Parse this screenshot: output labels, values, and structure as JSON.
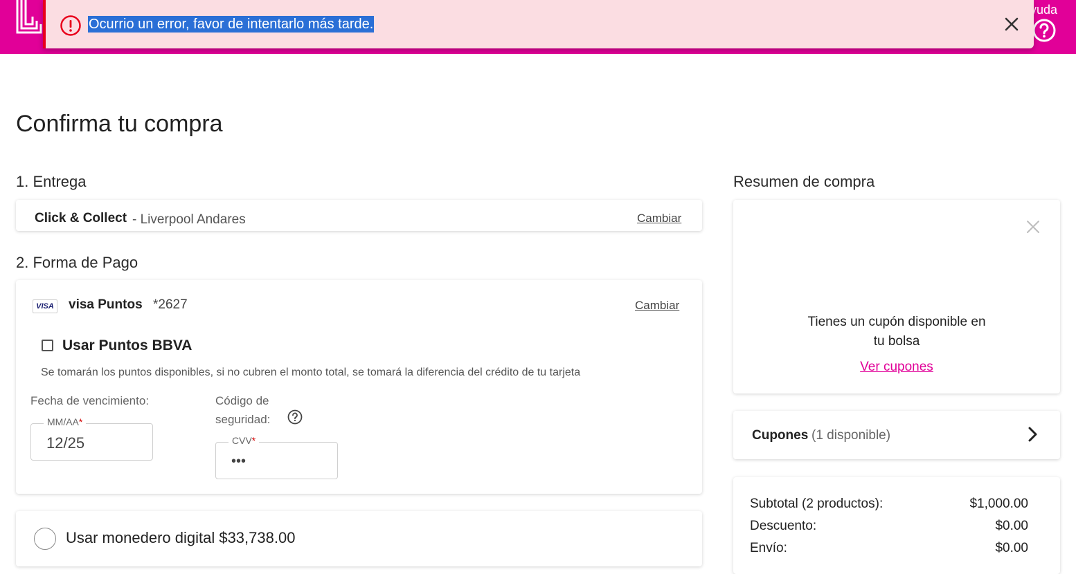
{
  "header": {
    "help_label": "yuda",
    "brand_color": "#e10098"
  },
  "alert": {
    "message": "Ocurrio un error, favor de intentarlo más tarde.",
    "icon": "error-circle-icon",
    "close_icon": "close-icon"
  },
  "page": {
    "title": "Confirma tu compra"
  },
  "delivery": {
    "heading": "1. Entrega",
    "method": "Click & Collect",
    "store": " - Liverpool Andares",
    "change_label": "Cambiar"
  },
  "payment": {
    "heading": "2. Forma de Pago",
    "card_brand": "VISA",
    "card_name": "visa Puntos",
    "card_number": "*2627",
    "change_label": "Cambiar",
    "points_label": "Usar Puntos BBVA",
    "points_note": "Se tomarán los puntos disponibles, si no cubren el monto total, se tomará la diferencia del crédito de tu tarjeta",
    "expiry_caption": "Fecha de vencimiento:",
    "expiry_legend": "MM/AA",
    "expiry_value": "12/25",
    "cvv_caption_1": "Código de",
    "cvv_caption_2": "seguridad:",
    "cvv_legend": "CVV",
    "cvv_value": "•••",
    "required_mark": "*"
  },
  "wallet": {
    "label": "Usar monedero digital $33,738.00"
  },
  "summary": {
    "heading": "Resumen de compra",
    "coupon_text_1": "Tienes un cupón disponible en",
    "coupon_text_2": "tu bolsa",
    "coupon_link": "Ver cupones",
    "coupons_label": "Cupones",
    "coupons_count": "(1 disponible)",
    "rows": [
      {
        "label": "Subtotal (2 productos):",
        "value": "$1,000.00"
      },
      {
        "label": "Descuento:",
        "value": "$0.00"
      },
      {
        "label": "Envío:",
        "value": "$0.00"
      }
    ]
  }
}
